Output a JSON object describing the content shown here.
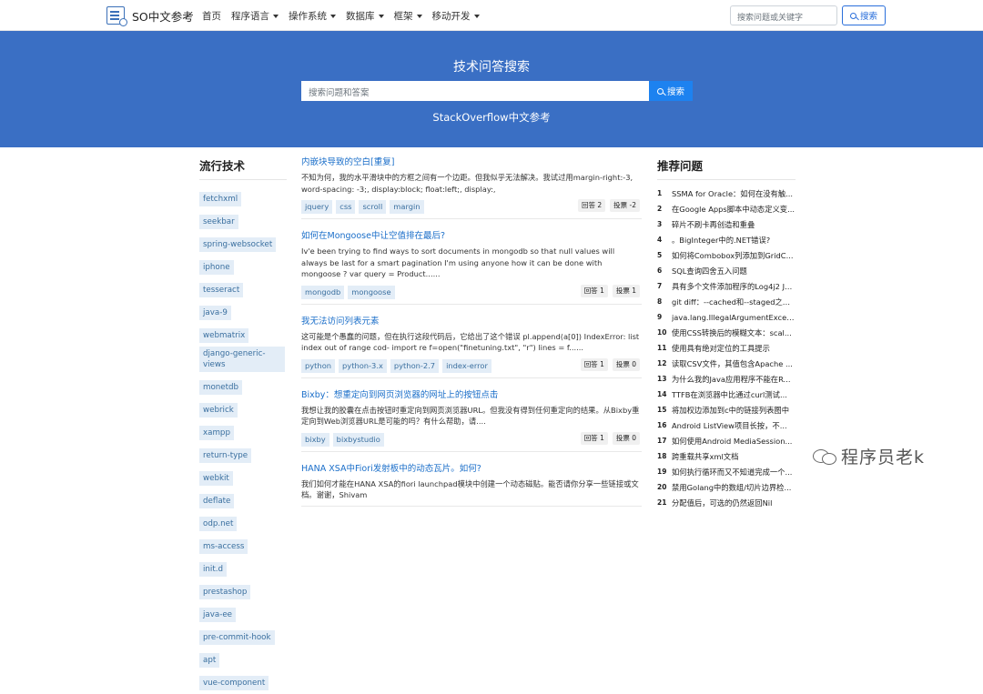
{
  "navbar": {
    "brand": "SO中文参考",
    "items": [
      {
        "label": "首页",
        "dropdown": false
      },
      {
        "label": "程序语言",
        "dropdown": true
      },
      {
        "label": "操作系统",
        "dropdown": true
      },
      {
        "label": "数据库",
        "dropdown": true
      },
      {
        "label": "框架",
        "dropdown": true
      },
      {
        "label": "移动开发",
        "dropdown": true
      }
    ],
    "search_placeholder": "搜索问题或关键字",
    "search_button": "搜索"
  },
  "hero": {
    "title": "技术问答搜索",
    "search_placeholder": "搜索问题和答案",
    "search_button": "搜索",
    "subtitle": "StackOverflow中文参考",
    "background": "#3a6fc4"
  },
  "left": {
    "title": "流行技术",
    "tags": [
      "fetchxml",
      "seekbar",
      "spring-websocket",
      "iphone",
      "tesseract",
      "java-9",
      "webmatrix",
      "django-generic-views",
      "monetdb",
      "webrick",
      "xampp",
      "return-type",
      "webkit",
      "deflate",
      "odp.net",
      "ms-access",
      "init.d",
      "prestashop",
      "java-ee",
      "pre-commit-hook",
      "apt",
      "vue-component"
    ]
  },
  "questions": [
    {
      "title": "内嵌块导致的空白[重复]",
      "excerpt": "不知为何，我的水平滑块中的方框之间有一个边距。但我似乎无法解决。我试过用margin-right:-3, word-spacing: -3;, display:block; float:left;, display:,",
      "tags": [
        "jquery",
        "css",
        "scroll",
        "margin"
      ],
      "answers": "回答 2",
      "votes": "投票 -2"
    },
    {
      "title": "如何在Mongoose中让空值排在最后?",
      "excerpt": "Iv'e been trying to find ways to sort documents in mongodb so that null values will always be last for a smart pagination I'm using anyone how it can be done with mongoose ? var query = Product......",
      "tags": [
        "mongodb",
        "mongoose"
      ],
      "answers": "回答 1",
      "votes": "投票 1"
    },
    {
      "title": "我无法访问列表元素",
      "excerpt": "这可能是个愚蠢的问题，但在执行这段代码后，它给出了这个错误 pl.append(a[0]) IndexError: list index out of range cod- import re f=open(\"finetuning.txt\", \"r\") lines = f......",
      "tags": [
        "python",
        "python-3.x",
        "python-2.7",
        "index-error"
      ],
      "answers": "回答 1",
      "votes": "投票 0"
    },
    {
      "title": "Bixby：想重定向到网页浏览器的网址上的按钮点击",
      "excerpt": "我想让我的胶囊在点击按钮时重定向到网页浏览器URL。但我没有得到任何重定向的结果。从Bixby重定向到Web浏览器URL是可能的吗？有什么帮助，请....",
      "tags": [
        "bixby",
        "bixbystudio"
      ],
      "answers": "回答 1",
      "votes": "投票 0"
    },
    {
      "title": "HANA XSA中Fiori发射板中的动态瓦片。如何?",
      "excerpt": "我们如何才能在HANA XSA的fiori launchpad模块中创建一个动态磁贴。能否请你分享一些链接或文档。谢谢，Shivam",
      "tags": [],
      "answers": "",
      "votes": ""
    }
  ],
  "right": {
    "title": "推荐问题",
    "items": [
      "SSMA for Oracle：如何在没有触...",
      "在Google Apps脚本中动态定义变...",
      "碎片不刷卡再创造和重叠",
      "。BigInteger中的.NET错误?",
      "如何将Combobox列添加到GridC...",
      "SQL查询四舍五入问题",
      "具有多个文件添加程序的Log4j2 Js...",
      "git diff：--cached和--staged之间...",
      "java.lang.IllegalArgumentExcept...",
      "使用CSS转换后的模糊文本：scal...",
      "使用具有绝对定位的工具提示",
      "读取CSV文件，其值包含Apache ...",
      "为什么我的Java应用程序不能在R...",
      "TTFB在浏览器中比通过curl测试...",
      "将加权边添加到c中的链接列表图中",
      "Android ListView项目长按，不...",
      "如何使用Android MediaSession...",
      "跨重载共享xml文档",
      "如何执行循环而又不知道完成一个...",
      "禁用Golang中的数组/切片边界检...",
      "分配值后，可选的仍然返回Nil"
    ]
  },
  "watermark": "程序员老k"
}
